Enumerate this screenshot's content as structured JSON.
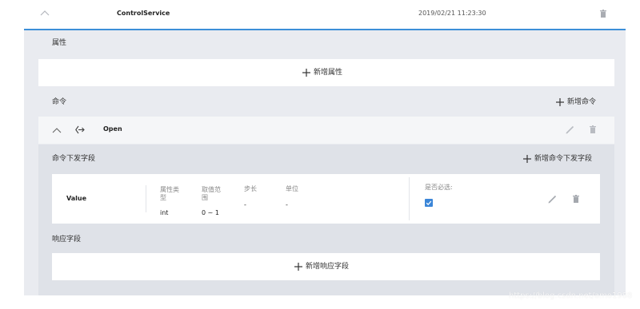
{
  "service": {
    "name": "ControlService",
    "timestamp": "2019/02/21 11:23:30",
    "collapse_icon": "chevron-up-icon",
    "delete_icon": "trash-icon"
  },
  "properties": {
    "section_label": "属性",
    "add_label": "新增属性"
  },
  "commands": {
    "section_label": "命令",
    "add_label": "新增命令",
    "items": [
      {
        "name": "Open",
        "command_icon": "command-arrow-icon",
        "down_fields": {
          "section_label": "命令下发字段",
          "add_label": "新增命令下发字段",
          "rows": [
            {
              "field_name": "Value",
              "type_label": "属性类型",
              "type_value": "int",
              "range_label": "取值范围",
              "range_value": "0 ~ 1",
              "step_label": "步长",
              "step_value": "-",
              "unit_label": "单位",
              "unit_value": "-",
              "required_label": "是否必选:",
              "required_checked": true
            }
          ]
        },
        "response_fields": {
          "section_label": "响应字段",
          "add_label": "新增响应字段"
        }
      }
    ]
  },
  "watermark": "https://blog.csdn.net/amo1988",
  "colors": {
    "accent_blue": "#3c8fd8",
    "panel_gray": "#e9ebf0",
    "row_gray": "#f5f6f8",
    "checkbox_blue": "#3b86d8"
  }
}
